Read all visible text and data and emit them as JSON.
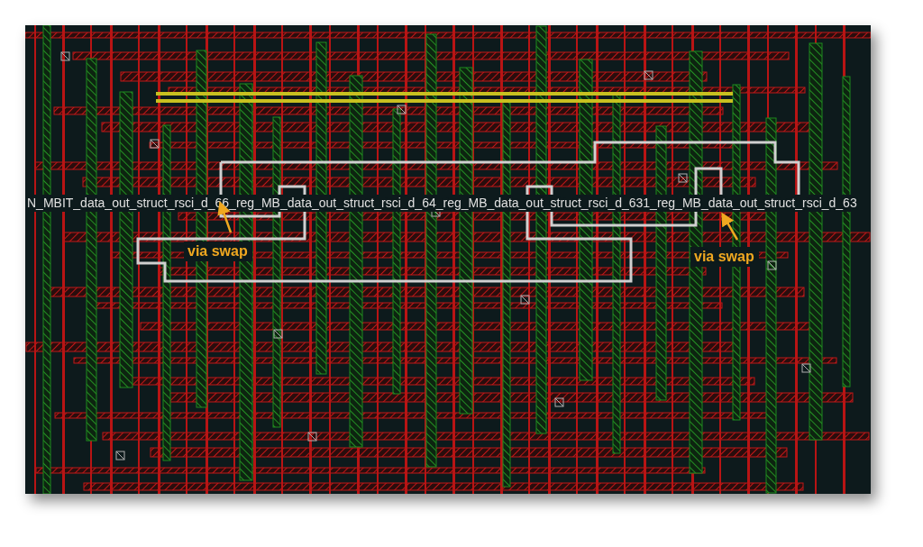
{
  "layout_view": {
    "net_label": "N_MBIT_data_out_struct_rsci_d_66_reg_MB_data_out_struct_rsci_d_64_reg_MB_data_out_struct_rsci_d_631_reg_MB_data_out_struct_rsci_d_63",
    "annotations": [
      {
        "label": "via swap"
      },
      {
        "label": "via swap"
      }
    ]
  }
}
